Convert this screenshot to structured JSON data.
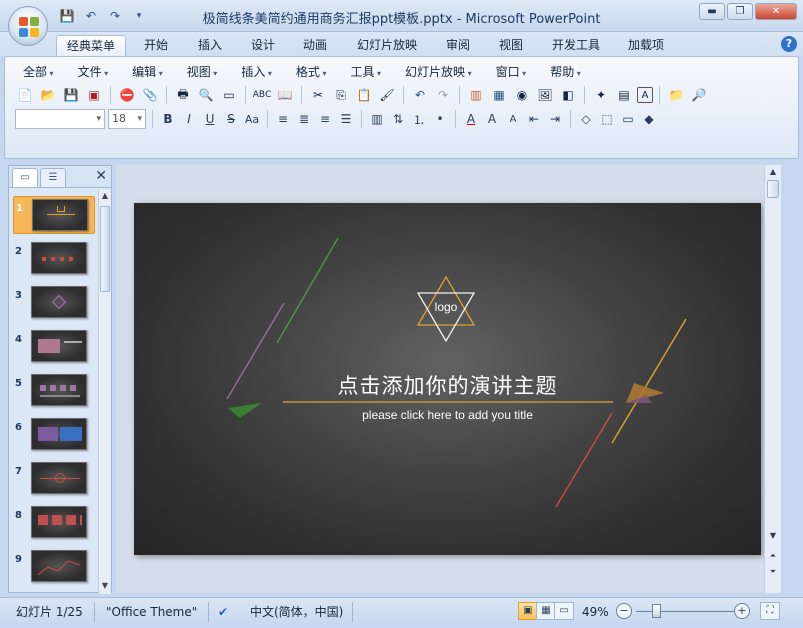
{
  "window": {
    "title": "极简线条美简约通用商务汇报ppt模板.pptx - Microsoft PowerPoint",
    "controls": [
      "minimize",
      "restore",
      "close"
    ]
  },
  "quick_access": [
    "save-icon",
    "undo-icon",
    "redo-icon"
  ],
  "ribbon_tabs": [
    {
      "label": "经典菜单",
      "active": true
    },
    {
      "label": "开始"
    },
    {
      "label": "插入"
    },
    {
      "label": "设计"
    },
    {
      "label": "动画"
    },
    {
      "label": "幻灯片放映"
    },
    {
      "label": "审阅"
    },
    {
      "label": "视图"
    },
    {
      "label": "开发工具"
    },
    {
      "label": "加载项"
    }
  ],
  "menus": [
    "全部",
    "文件",
    "编辑",
    "视图",
    "插入",
    "格式",
    "工具",
    "幻灯片放映",
    "窗口",
    "帮助"
  ],
  "format": {
    "font_name": "",
    "font_size": "18"
  },
  "slide_panel": {
    "thumbnails": [
      "1",
      "2",
      "3",
      "4",
      "5",
      "6",
      "7",
      "8",
      "9"
    ],
    "selected": "1"
  },
  "slide": {
    "logo_text": "logo",
    "title": "点击添加你的演讲主题",
    "subtitle": "please click here to add you title",
    "colors": {
      "background": "#3a3a3a",
      "accent_gold": "#e0a030",
      "accent_green": "#4a9a40",
      "accent_purple": "#9a6aa0",
      "accent_red": "#d04a44"
    }
  },
  "status": {
    "slide_count": "幻灯片 1/25",
    "theme": "\"Office Theme\"",
    "language": "中文(简体，中国)",
    "zoom": "49%"
  }
}
